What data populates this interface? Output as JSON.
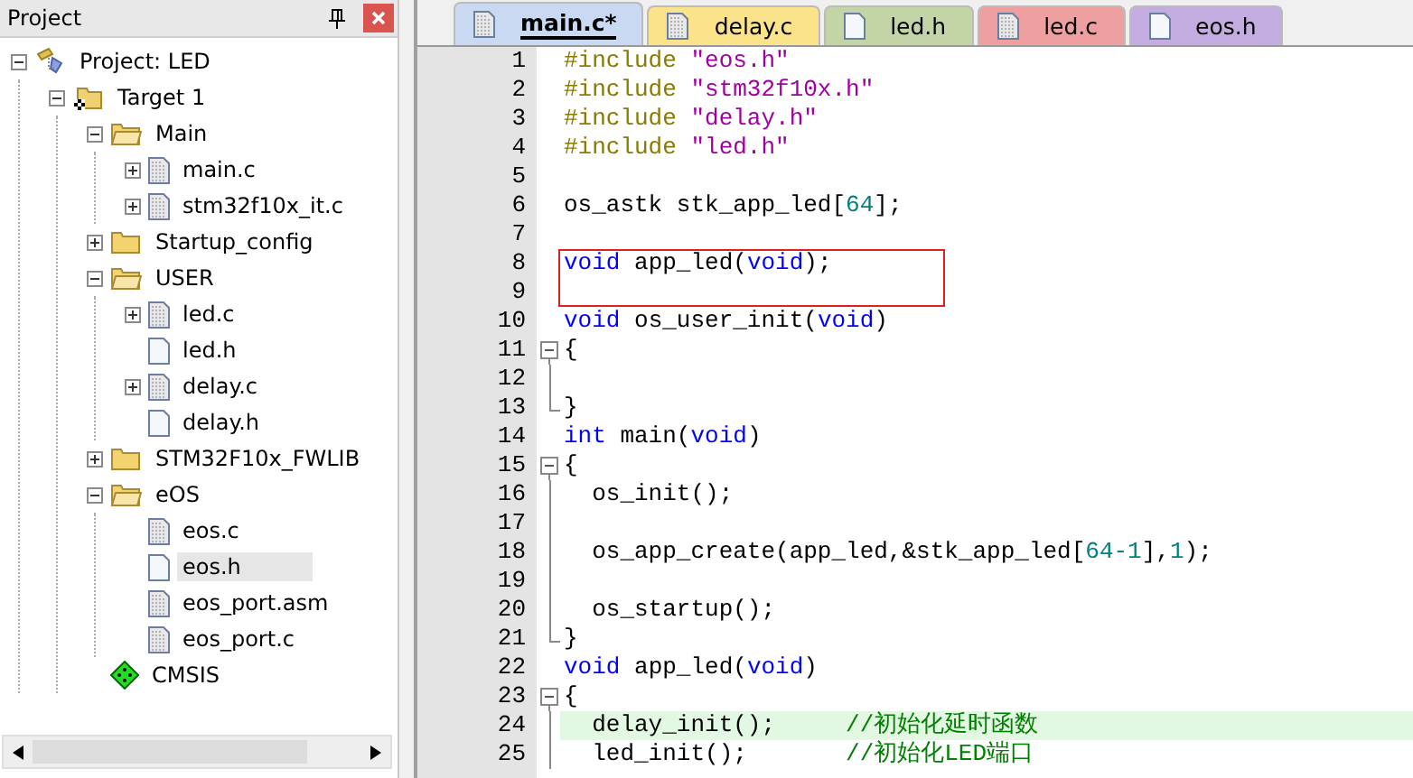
{
  "project_panel": {
    "title": "Project",
    "tree": [
      {
        "label": "Project: LED",
        "kind": "project",
        "expanded": true,
        "selected": false,
        "children": [
          {
            "label": "Target 1",
            "kind": "target",
            "expanded": true,
            "selected": false,
            "children": [
              {
                "label": "Main",
                "kind": "folder",
                "expanded": true,
                "selected": false,
                "children": [
                  {
                    "label": "main.c",
                    "kind": "source",
                    "expanded": false,
                    "selected": false
                  },
                  {
                    "label": "stm32f10x_it.c",
                    "kind": "source",
                    "expanded": false,
                    "selected": false
                  }
                ]
              },
              {
                "label": "Startup_config",
                "kind": "folder",
                "expanded": false,
                "selected": false
              },
              {
                "label": "USER",
                "kind": "folder",
                "expanded": true,
                "selected": false,
                "children": [
                  {
                    "label": "led.c",
                    "kind": "source",
                    "expanded": false,
                    "selected": false
                  },
                  {
                    "label": "led.h",
                    "kind": "header",
                    "selected": false
                  },
                  {
                    "label": "delay.c",
                    "kind": "source",
                    "expanded": false,
                    "selected": false
                  },
                  {
                    "label": "delay.h",
                    "kind": "header",
                    "selected": false
                  }
                ]
              },
              {
                "label": "STM32F10x_FWLIB",
                "kind": "folder",
                "expanded": false,
                "selected": false
              },
              {
                "label": "eOS",
                "kind": "folder",
                "expanded": true,
                "selected": false,
                "children": [
                  {
                    "label": "eos.c",
                    "kind": "source",
                    "selected": false
                  },
                  {
                    "label": "eos.h",
                    "kind": "header",
                    "selected": true
                  },
                  {
                    "label": "eos_port.asm",
                    "kind": "source",
                    "selected": false
                  },
                  {
                    "label": "eos_port.c",
                    "kind": "source",
                    "selected": false
                  }
                ]
              },
              {
                "label": "CMSIS",
                "kind": "component",
                "selected": false
              }
            ]
          }
        ]
      }
    ]
  },
  "editor": {
    "tabs": [
      {
        "label": "main.c*",
        "selected": true,
        "color": "#c9d9f2",
        "kind": "source"
      },
      {
        "label": "delay.c",
        "selected": false,
        "color": "#fbe38c",
        "kind": "source"
      },
      {
        "label": "led.h",
        "selected": false,
        "color": "#c3d5a6",
        "kind": "header"
      },
      {
        "label": "led.c",
        "selected": false,
        "color": "#ee9f9f",
        "kind": "source"
      },
      {
        "label": "eos.h",
        "selected": false,
        "color": "#c3ade0",
        "kind": "header"
      }
    ],
    "lines": [
      {
        "num": "1",
        "tokens": [
          {
            "kind": "preproc",
            "text": "#include "
          },
          {
            "kind": "string",
            "text": "\"eos.h\""
          }
        ]
      },
      {
        "num": "2",
        "tokens": [
          {
            "kind": "preproc",
            "text": "#include "
          },
          {
            "kind": "string",
            "text": "\"stm32f10x.h\""
          }
        ]
      },
      {
        "num": "3",
        "tokens": [
          {
            "kind": "preproc",
            "text": "#include "
          },
          {
            "kind": "string",
            "text": "\"delay.h\""
          }
        ]
      },
      {
        "num": "4",
        "tokens": [
          {
            "kind": "preproc",
            "text": "#include "
          },
          {
            "kind": "string",
            "text": "\"led.h\""
          }
        ]
      },
      {
        "num": "5"
      },
      {
        "num": "6",
        "tokens": [
          {
            "kind": "plain",
            "text": "os_astk stk_app_led["
          },
          {
            "kind": "number",
            "text": "64"
          },
          {
            "kind": "plain",
            "text": "];"
          }
        ]
      },
      {
        "num": "7"
      },
      {
        "num": "8",
        "boxed": true,
        "tokens": [
          {
            "kind": "keyword",
            "text": "void"
          },
          {
            "kind": "plain",
            "text": " app_led("
          },
          {
            "kind": "keyword",
            "text": "void"
          },
          {
            "kind": "plain",
            "text": ");"
          }
        ]
      },
      {
        "num": "9",
        "boxed": true
      },
      {
        "num": "10",
        "tokens": [
          {
            "kind": "keyword",
            "text": "void"
          },
          {
            "kind": "plain",
            "text": " os_user_init("
          },
          {
            "kind": "keyword",
            "text": "void"
          },
          {
            "kind": "plain",
            "text": ")"
          }
        ]
      },
      {
        "num": "11",
        "kind": "fold-start",
        "tokens": [
          {
            "kind": "plain",
            "text": "{"
          }
        ]
      },
      {
        "num": "12",
        "kind": "fold-mid"
      },
      {
        "num": "13",
        "kind": "fold-end",
        "tokens": [
          {
            "kind": "plain",
            "text": "}"
          }
        ]
      },
      {
        "num": "14",
        "tokens": [
          {
            "kind": "keyword",
            "text": "int"
          },
          {
            "kind": "plain",
            "text": " main("
          },
          {
            "kind": "keyword",
            "text": "void"
          },
          {
            "kind": "plain",
            "text": ")"
          }
        ]
      },
      {
        "num": "15",
        "kind": "fold-start",
        "tokens": [
          {
            "kind": "plain",
            "text": "{"
          }
        ]
      },
      {
        "num": "16",
        "kind": "fold-mid",
        "tokens": [
          {
            "kind": "plain",
            "text": "  os_init();"
          }
        ]
      },
      {
        "num": "17",
        "kind": "fold-mid"
      },
      {
        "num": "18",
        "kind": "fold-mid",
        "tokens": [
          {
            "kind": "plain",
            "text": "  os_app_create(app_led,&stk_app_led["
          },
          {
            "kind": "number",
            "text": "64-1"
          },
          {
            "kind": "plain",
            "text": "],"
          },
          {
            "kind": "number",
            "text": "1"
          },
          {
            "kind": "plain",
            "text": ");"
          }
        ]
      },
      {
        "num": "19",
        "kind": "fold-mid"
      },
      {
        "num": "20",
        "kind": "fold-mid",
        "tokens": [
          {
            "kind": "plain",
            "text": "  os_startup();"
          }
        ]
      },
      {
        "num": "21",
        "kind": "fold-end",
        "tokens": [
          {
            "kind": "plain",
            "text": "}"
          }
        ]
      },
      {
        "num": "22",
        "tokens": [
          {
            "kind": "keyword",
            "text": "void"
          },
          {
            "kind": "plain",
            "text": " app_led("
          },
          {
            "kind": "keyword",
            "text": "void"
          },
          {
            "kind": "plain",
            "text": ")"
          }
        ]
      },
      {
        "num": "23",
        "kind": "fold-start",
        "tokens": [
          {
            "kind": "plain",
            "text": "{"
          }
        ]
      },
      {
        "num": "24",
        "kind": "fold-mid",
        "highlighted": true,
        "tokens": [
          {
            "kind": "plain",
            "text": "  delay_init();     "
          },
          {
            "kind": "comment",
            "text": "//初始化延时函数"
          }
        ]
      },
      {
        "num": "25",
        "kind": "fold-mid",
        "tokens": [
          {
            "kind": "plain",
            "text": "  led_init();       "
          },
          {
            "kind": "comment",
            "text": "//初始化LED端口"
          }
        ]
      }
    ]
  }
}
